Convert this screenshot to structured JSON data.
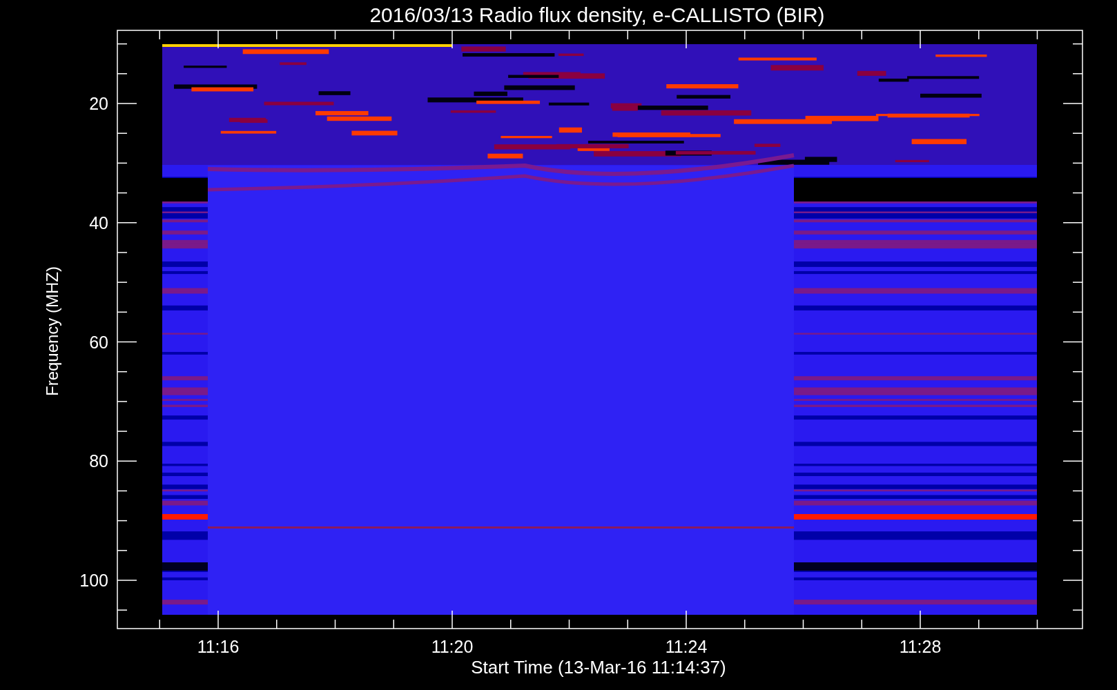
{
  "title": "2016/03/13  Radio flux density, e-CALLISTO (BIR)",
  "ylabel": "Frequency (MHZ)",
  "xlabel": "Start Time (13-Mar-16 11:14:37)",
  "yticks": [
    "20",
    "40",
    "60",
    "80",
    "100"
  ],
  "xticks": [
    "11:16",
    "11:20",
    "11:24",
    "11:28"
  ]
}
